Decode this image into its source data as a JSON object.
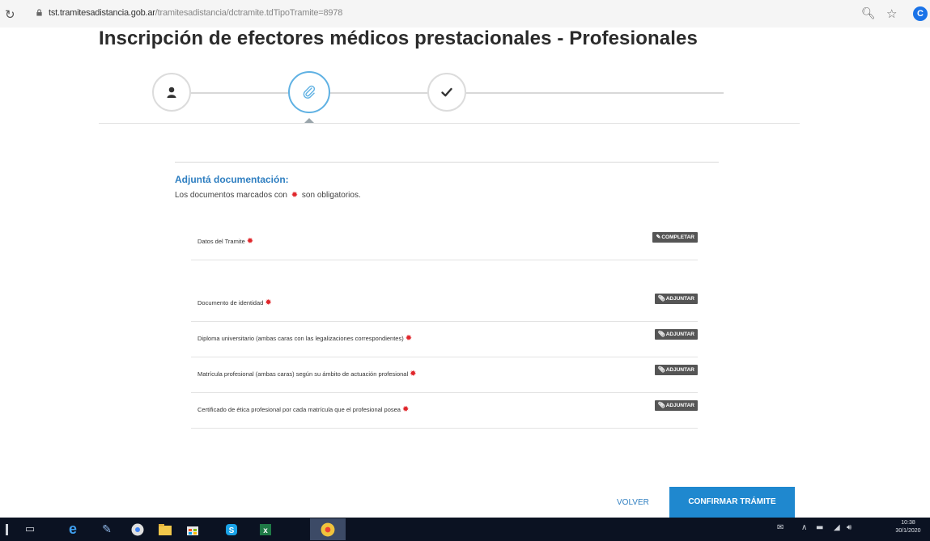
{
  "browser": {
    "url_main": "tst.tramitesadistancia.gob.ar",
    "url_rest": "/tramitesadistancia/dctramite.tdTipoTramite=8978",
    "profile_initial": "C"
  },
  "page": {
    "title": "Inscripción de efectores médicos prestacionales - Profesionales"
  },
  "stepper": {
    "steps": [
      {
        "icon": "user-icon"
      },
      {
        "icon": "paperclip-icon",
        "active": true
      },
      {
        "icon": "checkmark-icon"
      }
    ]
  },
  "section": {
    "title": "Adjuntá documentación:",
    "note_before": "Los documentos marcados con",
    "note_after": "son obligatorios."
  },
  "documents": [
    {
      "label": "Datos del Tramite",
      "button": "COMPLETAR",
      "button_icon": "pencil-icon"
    },
    {
      "label": "Documento de identidad",
      "button": "ADJUNTAR",
      "button_icon": "paperclip-icon"
    },
    {
      "label": "Diploma universitario (ambas caras con las legalizaciones correspondientes)",
      "button": "ADJUNTAR",
      "button_icon": "paperclip-icon"
    },
    {
      "label": "Matrícula profesional (ambas caras) según su ámbito de actuación profesional",
      "button": "ADJUNTAR",
      "button_icon": "paperclip-icon"
    },
    {
      "label": "Certificado de ética profesional por cada matrícula que el profesional posea",
      "button": "ADJUNTAR",
      "button_icon": "paperclip-icon"
    }
  ],
  "actions": {
    "back": "VOLVER",
    "confirm": "CONFIRMAR TRÁMITE"
  },
  "taskbar": {
    "clock_time": "10:38",
    "clock_date": "30/1/2020"
  },
  "colors": {
    "accent": "#1f88cf",
    "link": "#2f7fc1",
    "required": "#e0262b",
    "button_dark": "#555555",
    "taskbar": "#0b1222"
  }
}
